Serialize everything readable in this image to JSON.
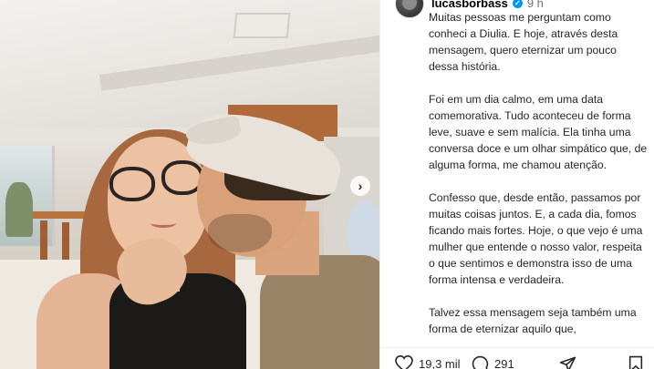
{
  "post": {
    "username": "lucasborbass",
    "time": "9 h",
    "caption_paragraphs": [
      "Muitas pessoas me perguntam como conheci a Diulia. E hoje, através desta mensagem, quero eternizar um pouco dessa história.",
      "Foi em um dia calmo, em uma data comemorativa. Tudo aconteceu de forma leve, suave e sem malícia. Ela tinha uma conversa doce e um olhar simpático que, de alguma forma, me chamou atenção.",
      "Confesso que, desde então, passamos por muitas coisas juntos. E, a cada dia, fomos ficando mais fortes. Hoje, o que vejo é uma mulher que entende o nosso valor, respeita o que sentimos e demonstra isso de uma forma intensa e verdadeira.",
      "Talvez essa mensagem seja também uma forma de eternizar aquilo que,"
    ],
    "likes": "19,3 mil",
    "comments": "291"
  },
  "colors": {
    "verified": "#0095f6",
    "text": "#262626",
    "muted": "#737373"
  },
  "icons": [
    "verified-icon",
    "chevron-right-icon",
    "heart-icon",
    "comment-icon",
    "share-icon",
    "bookmark-icon"
  ]
}
